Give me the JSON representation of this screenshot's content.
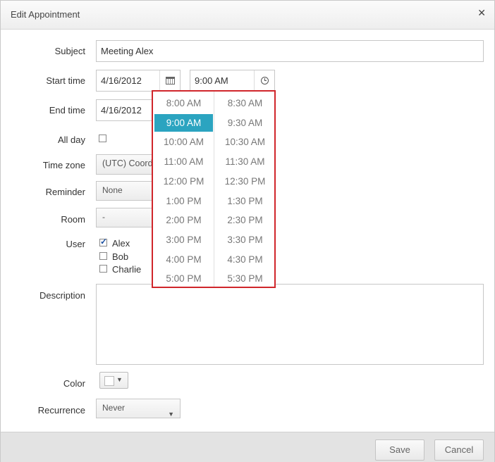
{
  "dialog": {
    "title": "Edit Appointment"
  },
  "form": {
    "subject_label": "Subject",
    "subject_value": "Meeting Alex",
    "start_label": "Start time",
    "start_date": "4/16/2012",
    "start_time": "9:00 AM",
    "end_label": "End time",
    "end_date": "4/16/2012",
    "allday_label": "All day",
    "timezone_label": "Time zone",
    "timezone_value": "(UTC) Coord",
    "reminder_label": "Reminder",
    "reminder_value": "None",
    "room_label": "Room",
    "room_value": "-",
    "user_label": "User",
    "users": [
      {
        "name": "Alex",
        "checked": true
      },
      {
        "name": "Bob",
        "checked": false
      },
      {
        "name": "Charlie",
        "checked": false
      }
    ],
    "description_label": "Description",
    "color_label": "Color",
    "recurrence_label": "Recurrence",
    "recurrence_value": "Never"
  },
  "time_dropdown": {
    "left": [
      "8:00 AM",
      "9:00 AM",
      "10:00 AM",
      "11:00 AM",
      "12:00 PM",
      "1:00 PM",
      "2:00 PM",
      "3:00 PM",
      "4:00 PM",
      "5:00 PM"
    ],
    "right": [
      "8:30 AM",
      "9:30 AM",
      "10:30 AM",
      "11:30 AM",
      "12:30 PM",
      "1:30 PM",
      "2:30 PM",
      "3:30 PM",
      "4:30 PM",
      "5:30 PM"
    ],
    "selected": "9:00 AM",
    "highlight_color": "#2ba4c0",
    "border_color": "#d0262b"
  },
  "footer": {
    "save_label": "Save",
    "cancel_label": "Cancel"
  }
}
